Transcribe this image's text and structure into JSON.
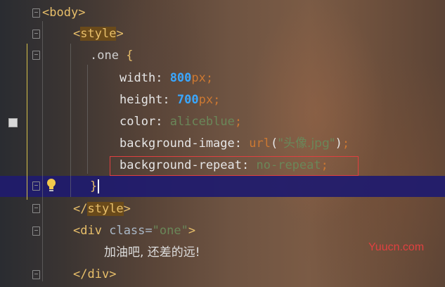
{
  "code": {
    "l1": {
      "open": "<",
      "tag": "body",
      "close": ">"
    },
    "l2": {
      "open": "<",
      "tag": "style",
      "close": ">"
    },
    "l3": {
      "selector": ".one",
      "brace": "{"
    },
    "l4": {
      "prop": "width",
      "colon": ":",
      "num": "800",
      "unit": "px",
      "semi": ";"
    },
    "l5": {
      "prop": "height",
      "colon": ":",
      "num": "700",
      "unit": "px",
      "semi": ";"
    },
    "l6": {
      "prop": "color",
      "colon": ":",
      "value": "aliceblue",
      "semi": ";"
    },
    "l7": {
      "prop": "background-image",
      "colon": ":",
      "fn": "url",
      "lp": "(",
      "value": "\"头像.jpg\"",
      "rp": ")",
      "semi": ";"
    },
    "l8": {
      "prop": "background-repeat",
      "colon": ":",
      "value": "no-repeat",
      "semi": ";"
    },
    "l9": {
      "brace": "}"
    },
    "l10": {
      "open": "</",
      "tag": "style",
      "close": ">"
    },
    "l11": {
      "open": "<",
      "tag": "div",
      "attr": "class",
      "eq": "=",
      "attrval": "\"one\"",
      "close": ">"
    },
    "l12": {
      "text": "加油吧, 还差的远!"
    },
    "l13": {
      "open": "</",
      "tag": "div",
      "close": ">"
    }
  },
  "watermark": "Yuucn.com",
  "colors": {
    "highlight": "#1f1b6e",
    "box": "#e04040",
    "tag": "#e8bf6a",
    "number": "#3aa7ff",
    "string": "#6a8759"
  },
  "icons": {
    "bulb": "lightbulb-icon",
    "fold": "fold-marker-icon",
    "bookmark": "bookmark-icon"
  }
}
